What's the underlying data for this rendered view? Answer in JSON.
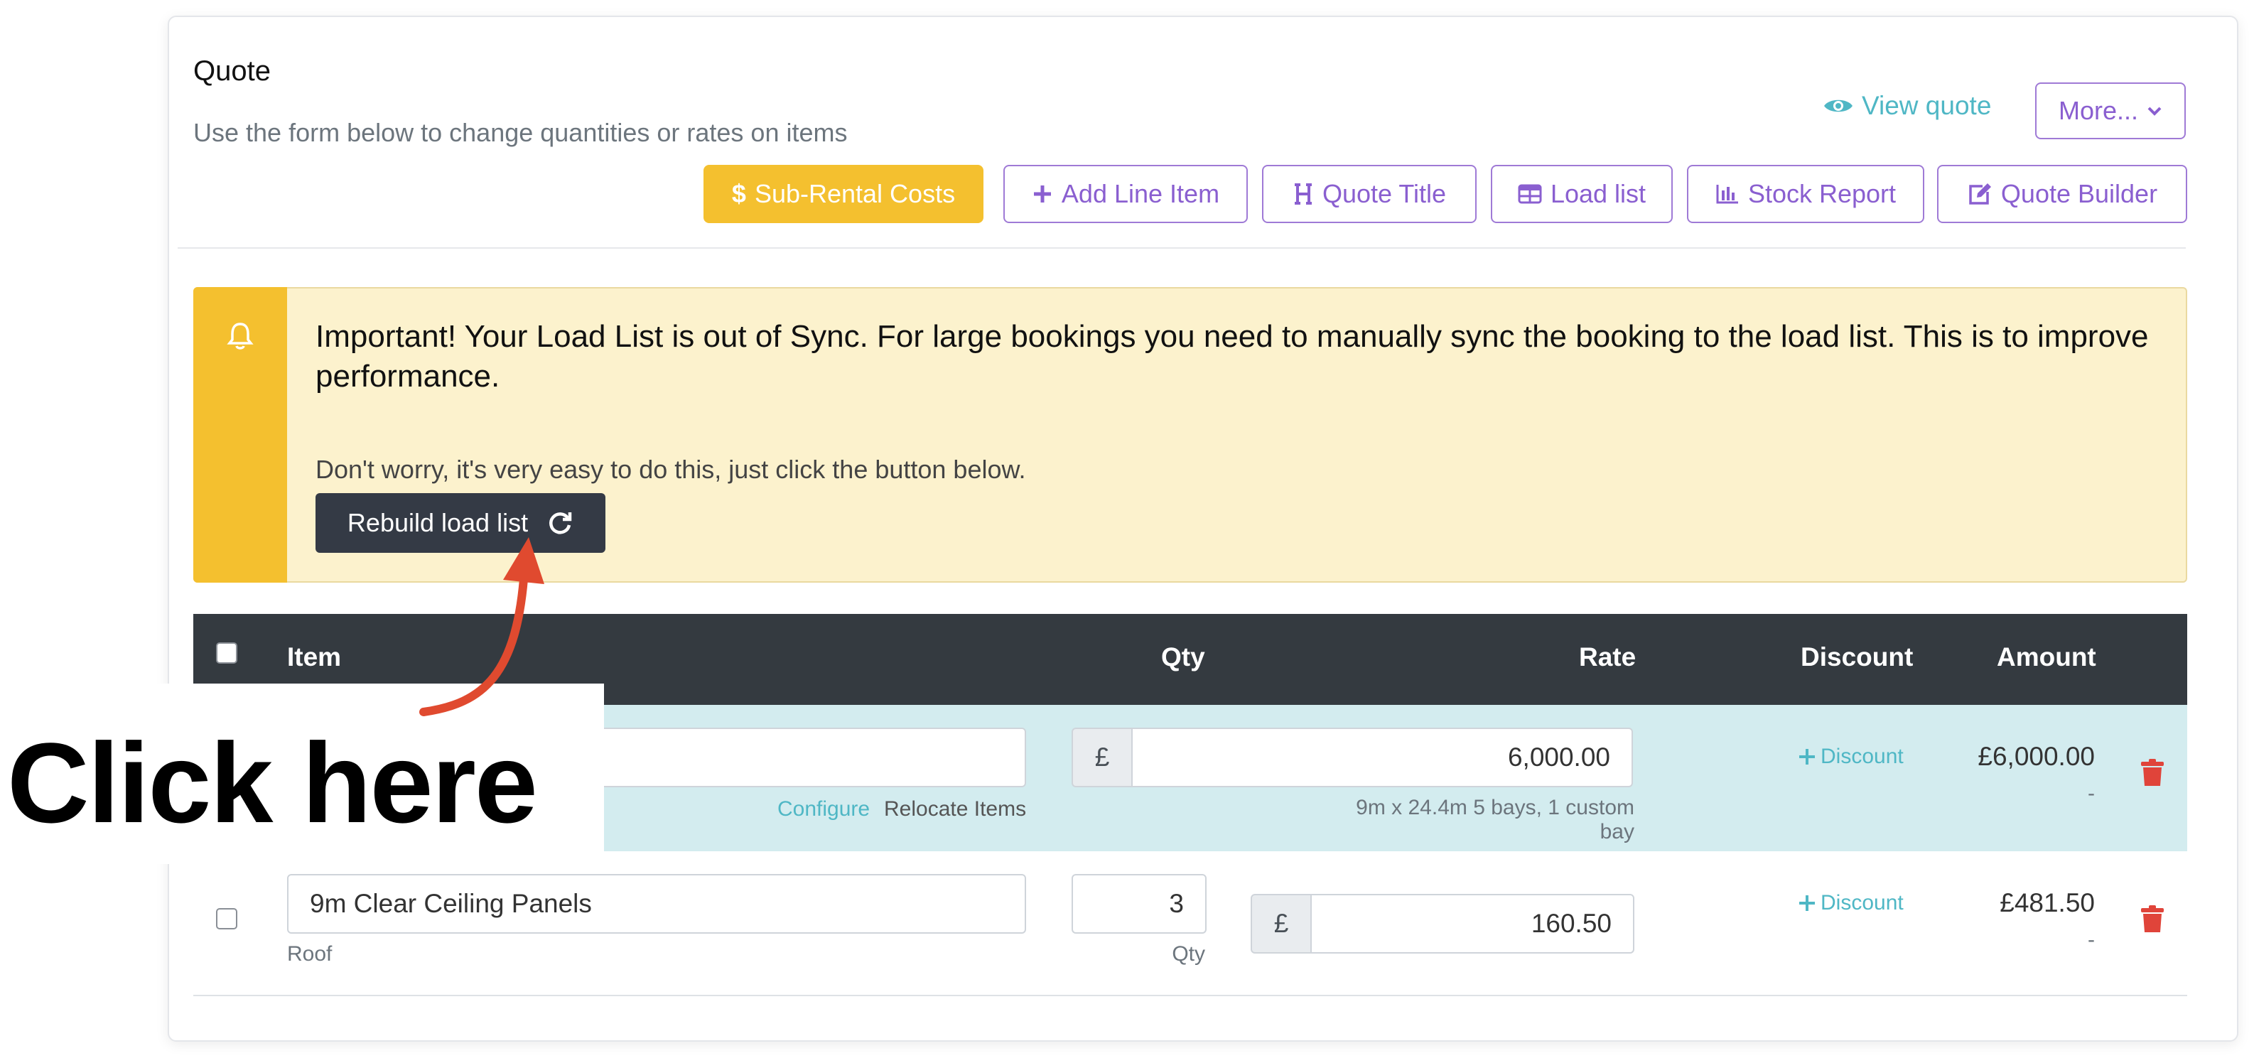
{
  "quote": {
    "title": "Quote",
    "subtitle": "Use the form below to change quantities or rates on items",
    "view_quote": "View quote",
    "more": "More..."
  },
  "toolbar": {
    "sub_rental": "Sub-Rental Costs",
    "add_line_item": "Add Line Item",
    "quote_title": "Quote Title",
    "load_list": "Load list",
    "stock_report": "Stock Report",
    "quote_builder": "Quote Builder"
  },
  "alert": {
    "message": "Important! Your Load List is out of Sync. For large bookings you need to manually sync the booking to the load list. This is to improve performance.",
    "note": "Don't worry, it's very easy to do this, just click the button below.",
    "button": "Rebuild load list"
  },
  "table": {
    "headers": {
      "item": "Item",
      "qty": "Qty",
      "rate": "Rate",
      "discount": "Discount",
      "amount": "Amount"
    },
    "rows": [
      {
        "item": "",
        "configure": "Configure",
        "relocate": "Relocate Items",
        "currency": "£",
        "rate": "6,000.00",
        "rate_note": "9m x 24.4m 5 bays, 1 custom bay",
        "discount": "Discount",
        "amount": "£6,000.00",
        "amount_sub": "-"
      },
      {
        "item": "9m Clear Ceiling Panels",
        "item_note": "Roof",
        "qty": "3",
        "qty_label": "Qty",
        "currency": "£",
        "rate": "160.50",
        "discount": "Discount",
        "amount": "£481.50",
        "amount_sub": "-"
      }
    ]
  },
  "callout": {
    "text": "Click here"
  },
  "colors": {
    "accent": "#8a5fd0",
    "link": "#4fb7c5",
    "warning": "#f4c02f",
    "alert_bg": "#fcf2cd",
    "header_dark": "#343a40",
    "row_highlight": "#d3ecef",
    "danger": "#e0443a"
  }
}
